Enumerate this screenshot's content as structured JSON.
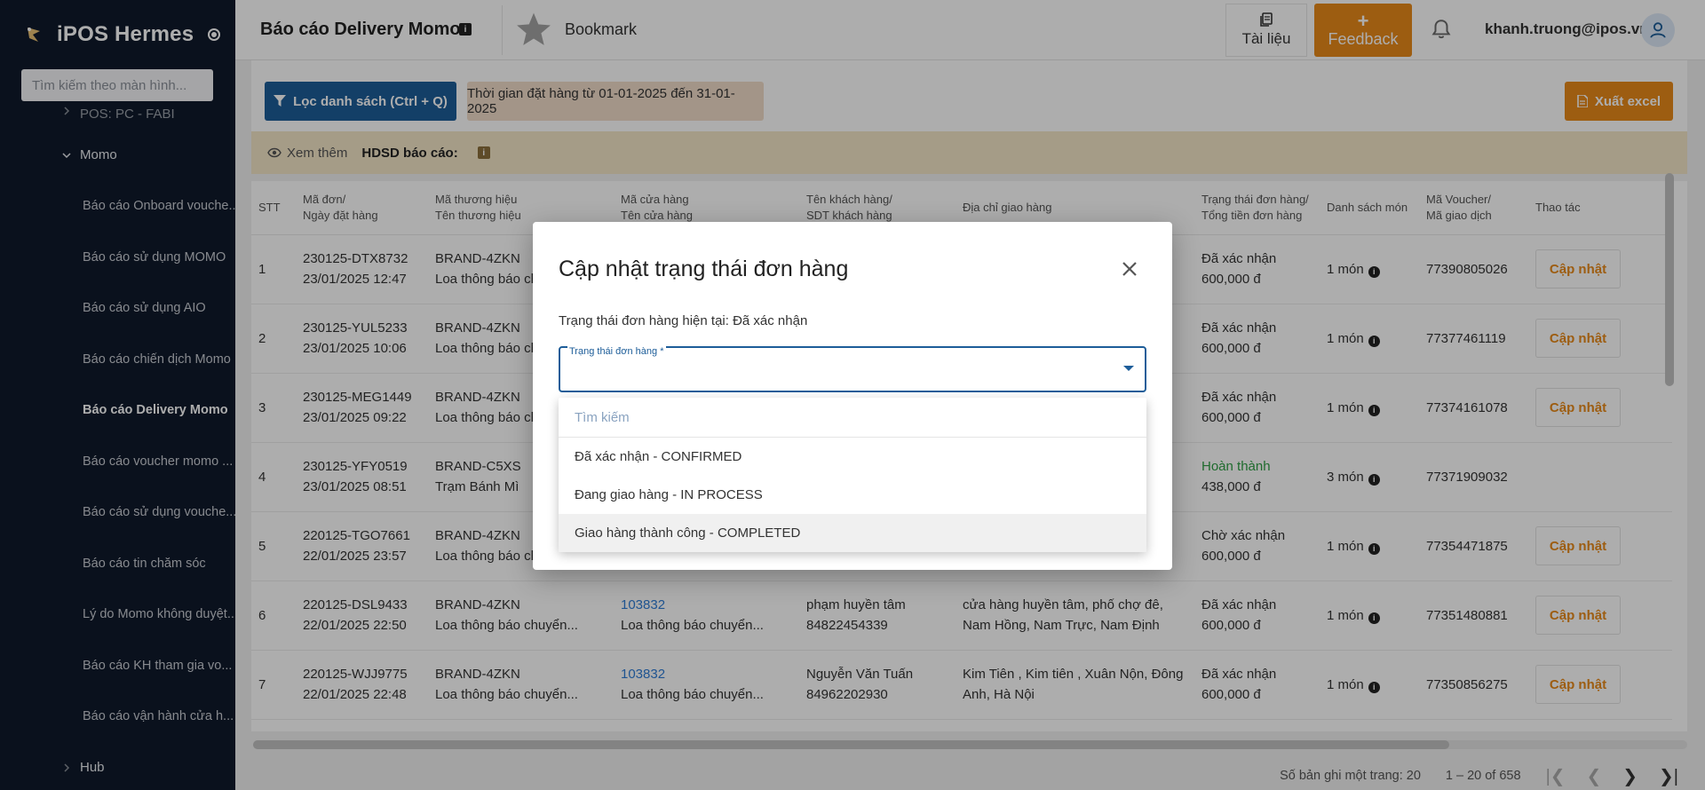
{
  "app": {
    "brand_name": "iPOS Hermes",
    "search_placeholder": "Tìm kiếm theo màn hình...",
    "sidebar_items": [
      {
        "type": "group",
        "label": "POS: PC - FABI",
        "expanded": false
      },
      {
        "type": "group",
        "label": "Momo",
        "expanded": true
      },
      {
        "type": "item",
        "label": "Báo cáo Onboard vouche...",
        "active": false
      },
      {
        "type": "item",
        "label": "Báo cáo sử dụng MOMO",
        "active": false
      },
      {
        "type": "item",
        "label": "Báo cáo sử dụng AIO",
        "active": false
      },
      {
        "type": "item",
        "label": "Báo cáo chiến dịch Momo",
        "active": false
      },
      {
        "type": "item",
        "label": "Báo cáo Delivery Momo",
        "active": true
      },
      {
        "type": "item",
        "label": "Báo cáo voucher momo ...",
        "active": false
      },
      {
        "type": "item",
        "label": "Báo cáo sử dụng vouche...",
        "active": false
      },
      {
        "type": "item",
        "label": "Báo cáo tin chăm sóc",
        "active": false
      },
      {
        "type": "item",
        "label": "Lý do Momo không duyệt...",
        "active": false
      },
      {
        "type": "item",
        "label": "Báo cáo KH tham gia vo...",
        "active": false
      },
      {
        "type": "item",
        "label": "Báo cáo vận hành cửa h...",
        "active": false
      },
      {
        "type": "group",
        "label": "Hub",
        "expanded": false
      }
    ]
  },
  "header": {
    "page_title": "Báo cáo Delivery Momo",
    "bookmark_label": "Bookmark",
    "docs_label": "Tài liệu",
    "feedback_label": "Feedback",
    "user_email": "khanh.truong@ipos.vn"
  },
  "toolbar": {
    "filter_label": "Lọc danh sách (Ctrl + Q)",
    "date_range": "Thời gian đặt hàng từ 01-01-2025 đến 31-01-2025",
    "export_label": "Xuất excel"
  },
  "notice": {
    "see_more": "Xem thêm",
    "guide_label": "HDSD báo cáo:"
  },
  "table": {
    "headers": [
      {
        "l1": "STT",
        "l2": ""
      },
      {
        "l1": "Mã đơn/",
        "l2": "Ngày đặt hàng"
      },
      {
        "l1": "Mã thương hiệu",
        "l2": "Tên thương hiệu"
      },
      {
        "l1": "Mã cửa hàng",
        "l2": "Tên cửa hàng"
      },
      {
        "l1": "Tên khách hàng/",
        "l2": "SDT khách hàng"
      },
      {
        "l1": "Địa chỉ giao hàng",
        "l2": ""
      },
      {
        "l1": "Trạng thái đơn hàng/",
        "l2": "Tổng tiền đơn hàng"
      },
      {
        "l1": "Danh sách món",
        "l2": ""
      },
      {
        "l1": "Mã Voucher/",
        "l2": "Mã giao dịch"
      },
      {
        "l1": "Thao tác",
        "l2": ""
      }
    ],
    "rows": [
      {
        "stt": "1",
        "order": "230125-DTX8732",
        "date": "23/01/2025 12:47",
        "brand_code": "BRAND-4ZKN",
        "brand_name": "Loa thông báo chuyển...",
        "store_code": "",
        "store_name": "",
        "cust_name": "",
        "cust_phone": "",
        "addr1": "...51,",
        "addr2": "...i",
        "status": "Đã xác nhận",
        "total": "600,000 đ",
        "items": "1 món",
        "voucher": "77390805026",
        "action": "Cập nhật",
        "status_color": ""
      },
      {
        "stt": "2",
        "order": "230125-YUL5233",
        "date": "23/01/2025 10:06",
        "brand_code": "BRAND-4ZKN",
        "brand_name": "Loa thông báo chuyển...",
        "store_code": "",
        "store_name": "",
        "cust_name": "",
        "cust_phone": "",
        "addr1": "",
        "addr2": "...Th...",
        "status": "Đã xác nhận",
        "total": "600,000 đ",
        "items": "1 món",
        "voucher": "77377461119",
        "action": "Cập nhật",
        "status_color": ""
      },
      {
        "stt": "3",
        "order": "230125-MEG1449",
        "date": "23/01/2025 09:22",
        "brand_code": "BRAND-4ZKN",
        "brand_name": "Loa thông báo chuyển...",
        "store_code": "",
        "store_name": "",
        "cust_name": "",
        "cust_phone": "",
        "addr1": "",
        "addr2": "",
        "status": "Đã xác nhận",
        "total": "600,000 đ",
        "items": "1 món",
        "voucher": "77374161078",
        "action": "Cập nhật",
        "status_color": ""
      },
      {
        "stt": "4",
        "order": "230125-YFY0519",
        "date": "23/01/2025 08:51",
        "brand_code": "BRAND-C5XS",
        "brand_name": "Trạm Bánh Mì",
        "store_code": "",
        "store_name": "",
        "cust_name": "",
        "cust_phone": "",
        "addr1": "...ng,",
        "addr2": "",
        "status": "Hoàn thành",
        "total": "438,000 đ",
        "items": "3 món",
        "voucher": "77371909032",
        "action": "",
        "status_color": "#2f9e44"
      },
      {
        "stt": "5",
        "order": "220125-TGO7661",
        "date": "22/01/2025 23:57",
        "brand_code": "BRAND-4ZKN",
        "brand_name": "Loa thông báo chuyển...",
        "store_code": "",
        "store_name": "",
        "cust_name": "",
        "cust_phone": "",
        "addr1": "...,",
        "addr2": "",
        "status": "Chờ xác nhận",
        "total": "600,000 đ",
        "items": "1 món",
        "voucher": "77354471875",
        "action": "Cập nhật",
        "status_color": ""
      },
      {
        "stt": "6",
        "order": "220125-DSL9433",
        "date": "22/01/2025 22:50",
        "brand_code": "BRAND-4ZKN",
        "brand_name": "Loa thông báo chuyển...",
        "store_code": "103832",
        "store_name": "Loa thông báo chuyển...",
        "cust_name": "phạm huyền tâm",
        "cust_phone": "84822454339",
        "addr1": "cửa hàng huyền tâm, phố chợ đê,",
        "addr2": "Nam Hồng, Nam Trực, Nam Định",
        "status": "Đã xác nhận",
        "total": "600,000 đ",
        "items": "1 món",
        "voucher": "77351480881",
        "action": "Cập nhật",
        "status_color": ""
      },
      {
        "stt": "7",
        "order": "220125-WJJ9775",
        "date": "22/01/2025 22:48",
        "brand_code": "BRAND-4ZKN",
        "brand_name": "Loa thông báo chuyển...",
        "store_code": "103832",
        "store_name": "Loa thông báo chuyển...",
        "cust_name": "Nguyễn Văn Tuấn",
        "cust_phone": "84962202930",
        "addr1": "Kim Tiên , Kim tiên , Xuân Nộn, Đông",
        "addr2": "Anh, Hà Nội",
        "status": "Đã xác nhận",
        "total": "600,000 đ",
        "items": "1 món",
        "voucher": "77350856275",
        "action": "Cập nhật",
        "status_color": ""
      }
    ]
  },
  "footer": {
    "rows_per_page_label": "Số bản ghi một trang: 20",
    "range_label": "1 – 20 of 658"
  },
  "modal": {
    "title": "Cập nhật trạng thái đơn hàng",
    "current_status": "Trạng thái đơn hàng hiện tại: Đã xác nhận",
    "select_label": "Trạng thái đơn hàng *",
    "search_placeholder": "Tìm kiếm",
    "options": [
      {
        "label": "Đã xác nhận - CONFIRMED",
        "highlighted": false
      },
      {
        "label": "Đang giao hàng - IN PROCESS",
        "highlighted": false
      },
      {
        "label": "Giao hàng thành công - COMPLETED",
        "highlighted": true
      }
    ]
  },
  "colors": {
    "sidebar_bg": "#0f1a2b",
    "primary": "#1d5d99",
    "accent": "#e8891a",
    "success": "#2f9e44",
    "link": "#2e7cd6"
  }
}
